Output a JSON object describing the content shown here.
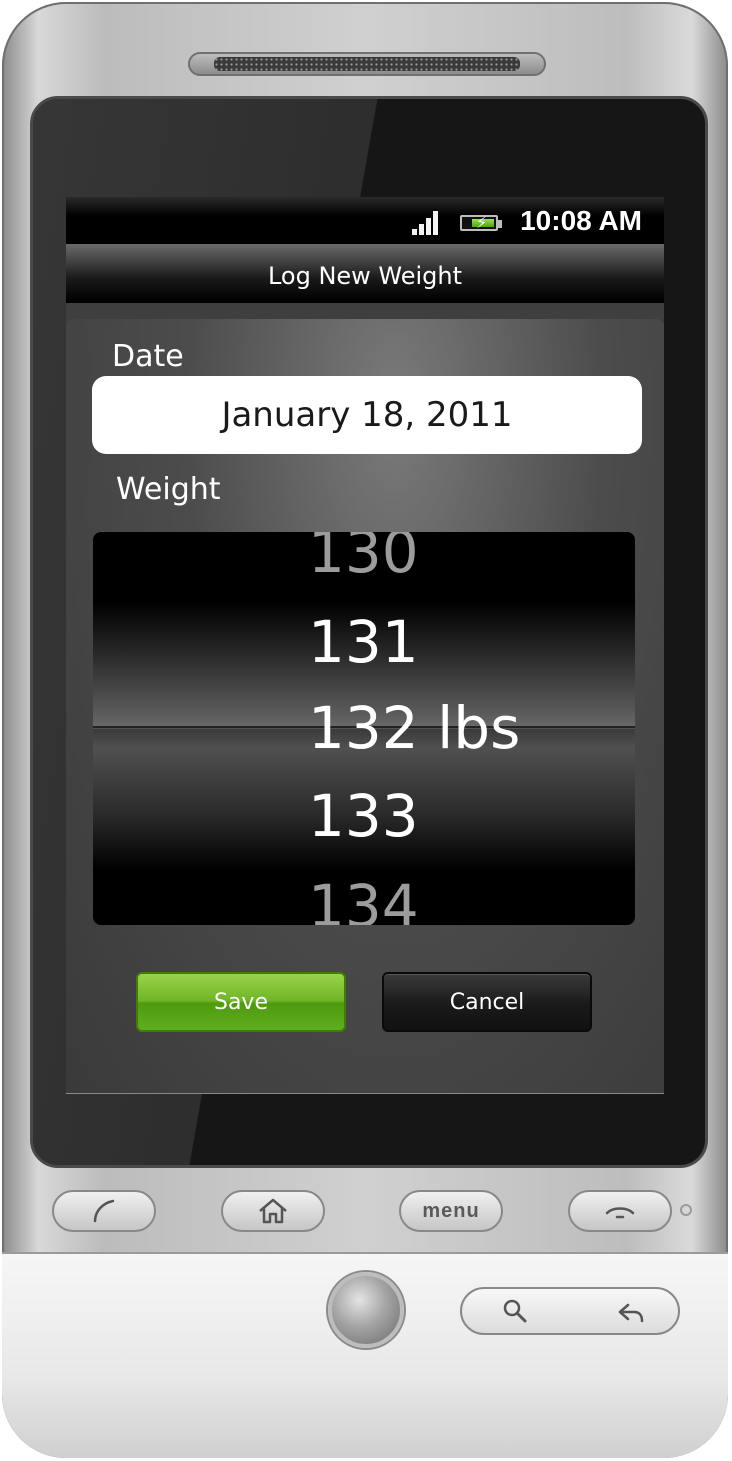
{
  "status_bar": {
    "time": "10:08 AM",
    "signal_icon": "signal-bars-icon",
    "battery_icon": "battery-charging-icon"
  },
  "title_bar": {
    "title": "Log New Weight"
  },
  "form": {
    "date_label": "Date",
    "date_value": "January 18, 2011",
    "weight_label": "Weight"
  },
  "weight_picker": {
    "items": [
      "130",
      "131",
      "132 lbs",
      "133",
      "134"
    ],
    "selected": "132 lbs"
  },
  "buttons": {
    "save_label": "Save",
    "cancel_label": "Cancel"
  },
  "hardware": {
    "menu_label": "menu"
  },
  "colors": {
    "save_green": "#6fb526",
    "screen_background": "#3f3f3f",
    "status_bar": "#000000"
  }
}
